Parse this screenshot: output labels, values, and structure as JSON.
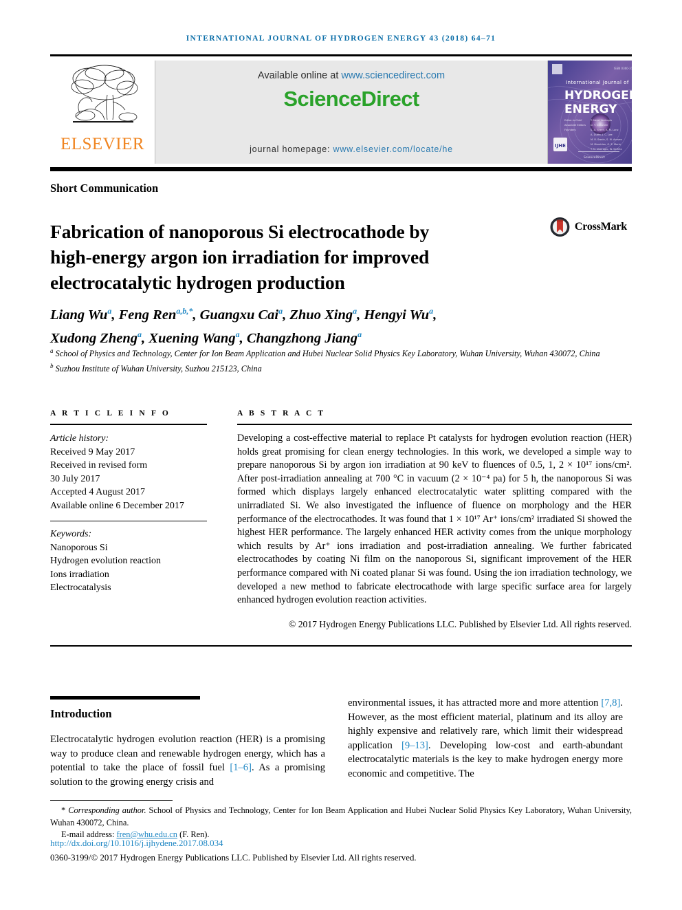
{
  "running_head": "International Journal of Hydrogen Energy 43 (2018) 64–71",
  "banner": {
    "publisher_logo_text": "ELSEVIER",
    "tree_icon": "elsevier-tree-icon",
    "available_prefix": "Available online at ",
    "available_url": "www.sciencedirect.com",
    "sciencedirect_logo": "ScienceDirect",
    "homepage_prefix": "journal homepage: ",
    "homepage_url": "www.elsevier.com/locate/he",
    "cover": {
      "line1": "International Journal of",
      "line2": "HYDROGEN",
      "line3": "ENERGY",
      "footer_badge": "IJHE"
    }
  },
  "article": {
    "section_type": "Short Communication",
    "title": "Fabrication of nanoporous Si electrocathode by high-energy argon ion irradiation for improved electrocatalytic hydrogen production",
    "crossmark_label": "CrossMark",
    "authors_line1_parts": [
      {
        "name": "Liang Wu",
        "marks": "a"
      },
      {
        "name": "Feng Ren",
        "marks": "a,b,*"
      },
      {
        "name": "Guangxu Cai",
        "marks": "a"
      },
      {
        "name": "Zhuo Xing",
        "marks": "a"
      },
      {
        "name": "Hengyi Wu",
        "marks": "a"
      }
    ],
    "authors_line2_parts": [
      {
        "name": "Xudong Zheng",
        "marks": "a"
      },
      {
        "name": "Xuening Wang",
        "marks": "a"
      },
      {
        "name": "Changzhong Jiang",
        "marks": "a"
      }
    ],
    "affiliation_a": "School of Physics and Technology, Center for Ion Beam Application and Hubei Nuclear Solid Physics Key Laboratory, Wuhan University, Wuhan 430072, China",
    "affiliation_b": "Suzhou Institute of Wuhan University, Suzhou 215123, China"
  },
  "article_info": {
    "heading": "A R T I C L E   I N F O",
    "history_label": "Article history:",
    "history": [
      "Received 9 May 2017",
      "Received in revised form",
      "30 July 2017",
      "Accepted 4 August 2017",
      "Available online 6 December 2017"
    ],
    "keywords_label": "Keywords:",
    "keywords": [
      "Nanoporous Si",
      "Hydrogen evolution reaction",
      "Ions irradiation",
      "Electrocatalysis"
    ]
  },
  "abstract": {
    "heading": "A B S T R A C T",
    "text": "Developing a cost-effective material to replace Pt catalysts for hydrogen evolution reaction (HER) holds great promising for clean energy technologies. In this work, we developed a simple way to prepare nanoporous Si by argon ion irradiation at 90 keV to fluences of 0.5, 1, 2 × 10¹⁷ ions/cm². After post-irradiation annealing at 700 °C in vacuum (2 × 10⁻⁴ pa) for 5 h, the nanoporous Si was formed which displays largely enhanced electrocatalytic water splitting compared with the unirradiated Si. We also investigated the influence of fluence on morphology and the HER performance of the electrocathodes. It was found that 1 × 10¹⁷ Ar⁺ ions/cm² irradiated Si showed the highest HER performance. The largely enhanced HER activity comes from the unique morphology which results by Ar⁺ ions irradiation and post-irradiation annealing. We further fabricated electrocathodes by coating Ni film on the nanoporous Si, significant improvement of the HER performance compared with Ni coated planar Si was found. Using the ion irradiation technology, we developed a new method to fabricate electrocathode with large specific surface area for largely enhanced hydrogen evolution reaction activities.",
    "copyright": "© 2017 Hydrogen Energy Publications LLC. Published by Elsevier Ltd. All rights reserved."
  },
  "introduction": {
    "heading": "Introduction",
    "left_col_pre": "Electrocatalytic hydrogen evolution reaction (HER) is a promising way to produce clean and renewable hydrogen energy, which has a potential to take the place of fossil fuel ",
    "left_ref_1": "[1–6]",
    "left_col_post": ". As a promising solution to the growing energy crisis and",
    "right_seg_1": "environmental issues, it has attracted more and more attention ",
    "right_ref_1": "[7,8]",
    "right_seg_2": ". However, as the most efficient material, platinum and its alloy are highly expensive and relatively rare, which limit their widespread application ",
    "right_ref_2": "[9–13]",
    "right_seg_3": ". Developing low-cost and earth-abundant electrocatalytic materials is the key to make hydrogen energy more economic and competitive. The"
  },
  "footer": {
    "corresponding_star": "*",
    "corresponding_italic": "Corresponding author.",
    "corresponding_rest": " School of Physics and Technology, Center for Ion Beam Application and Hubei Nuclear Solid Physics Key Laboratory, Wuhan University, Wuhan 430072, China.",
    "email_label": "E-mail address: ",
    "email_value": "fren@whu.edu.cn",
    "email_suffix": " (F. Ren).",
    "doi": "http://dx.doi.org/10.1016/j.ijhydene.2017.08.034",
    "issn_line": "0360-3199/© 2017 Hydrogen Energy Publications LLC. Published by Elsevier Ltd. All rights reserved."
  }
}
